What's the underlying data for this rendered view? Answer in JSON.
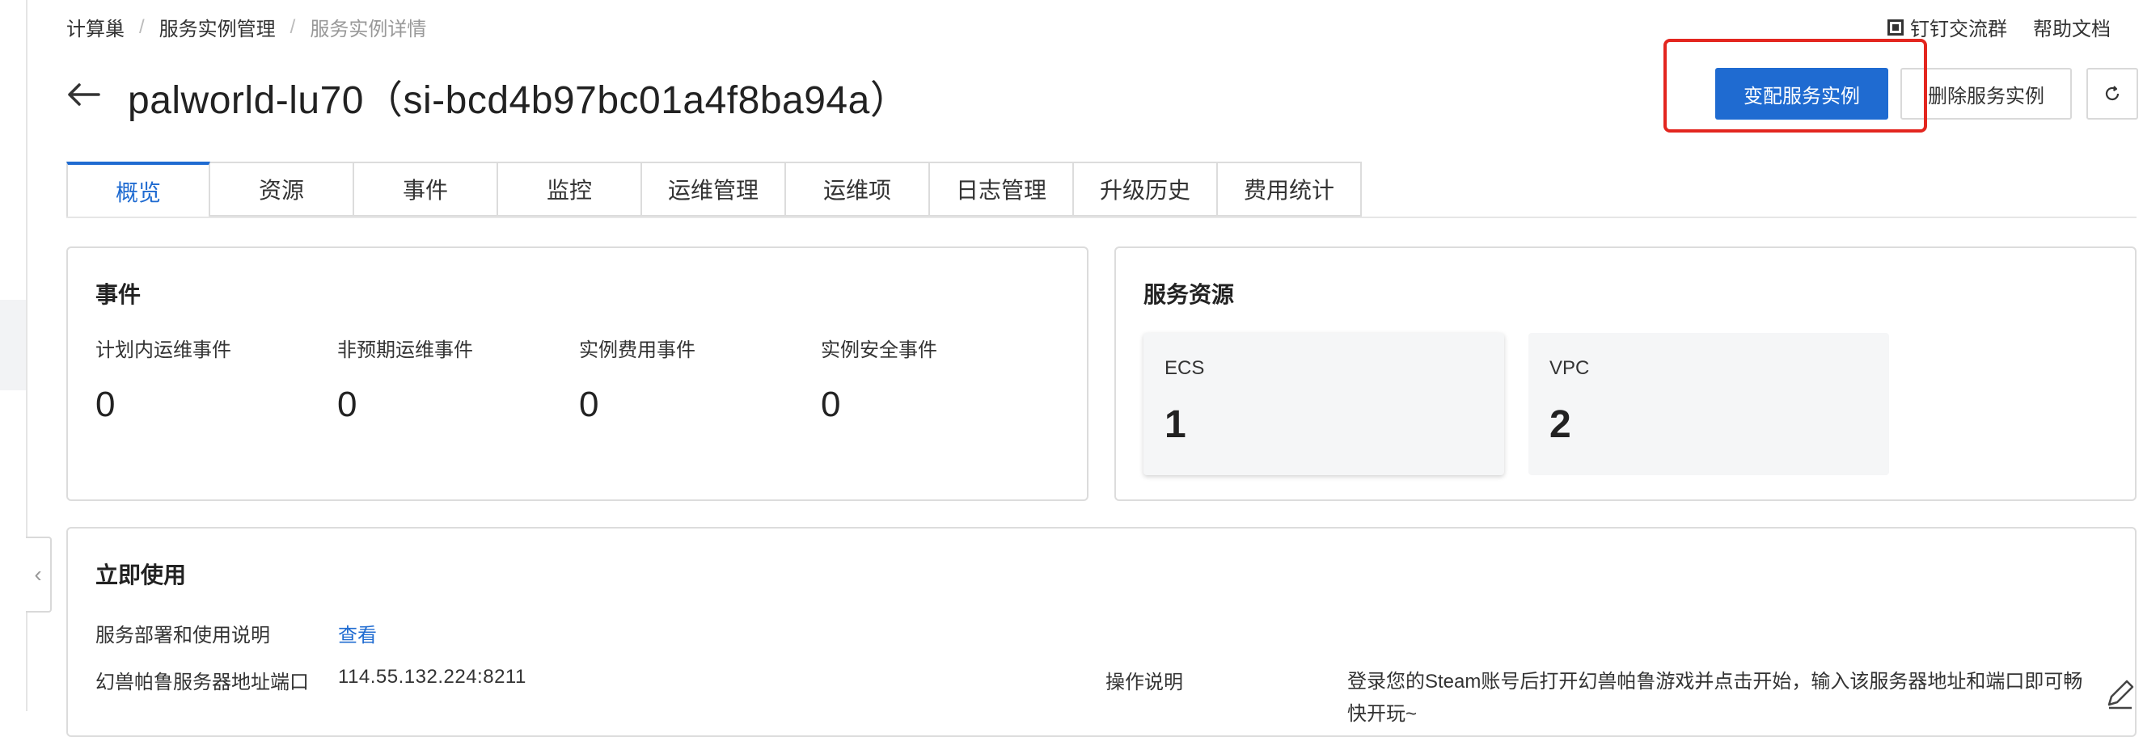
{
  "breadcrumb": [
    "计算巢",
    "服务实例管理",
    "服务实例详情"
  ],
  "top_links": {
    "dingtalk": "钉钉交流群",
    "help": "帮助文档"
  },
  "title": "palworld-lu70（si-bcd4b97bc01a4f8ba94a）",
  "buttons": {
    "modify": "变配服务实例",
    "delete": "删除服务实例"
  },
  "tabs": [
    "概览",
    "资源",
    "事件",
    "监控",
    "运维管理",
    "运维项",
    "日志管理",
    "升级历史",
    "费用统计"
  ],
  "events": {
    "title": "事件",
    "items": [
      {
        "label": "计划内运维事件",
        "value": "0"
      },
      {
        "label": "非预期运维事件",
        "value": "0"
      },
      {
        "label": "实例费用事件",
        "value": "0"
      },
      {
        "label": "实例安全事件",
        "value": "0"
      }
    ]
  },
  "resources": {
    "title": "服务资源",
    "items": [
      {
        "name": "ECS",
        "value": "1"
      },
      {
        "name": "VPC",
        "value": "2"
      }
    ]
  },
  "use": {
    "title": "立即使用",
    "deploy_label": "服务部署和使用说明",
    "deploy_link": "查看",
    "addr_label": "幻兽帕鲁服务器地址端口",
    "addr_value": "114.55.132.224:8211",
    "op_label": "操作说明",
    "op_value": "登录您的Steam账号后打开幻兽帕鲁游戏并点击开始，输入该服务器地址和端口即可畅快开玩~"
  },
  "colors": {
    "primary": "#1f6bd1",
    "highlight": "#e3261f"
  },
  "icons": [
    "back-arrow-icon",
    "qr-code-icon",
    "refresh-icon",
    "chevron-left-icon",
    "edit-icon"
  ]
}
